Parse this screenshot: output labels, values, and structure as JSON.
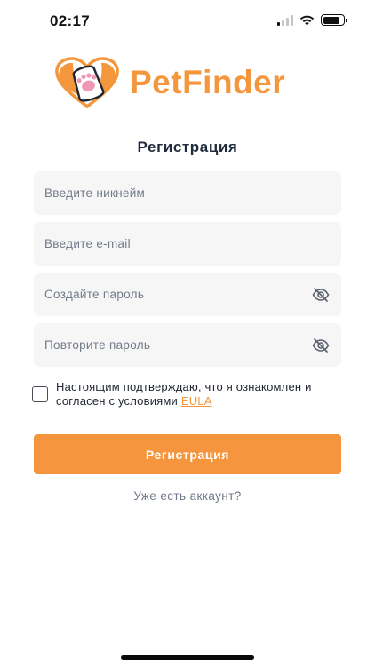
{
  "status_bar": {
    "time": "02:17",
    "signal_bars_active": 1,
    "battery_level": 0.85,
    "icons": [
      "signal-icon",
      "wifi-icon",
      "battery-icon"
    ]
  },
  "brand": {
    "name": "PetFinder",
    "logo_icon": "heart-paw-icon",
    "accent_color": "#f4963c"
  },
  "form": {
    "title": "Регистрация",
    "nickname_placeholder": "Введите никнейм",
    "email_placeholder": "Введите e-mail",
    "password_placeholder": "Создайте пароль",
    "repeat_password_placeholder": "Повторите пароль",
    "password_toggle_icon": "eye-off-icon",
    "eula_text": "Настоящим подтверждаю, что я ознакомлен и согласен с условиями ",
    "eula_link": "EULA",
    "eula_checked": false,
    "submit_label": "Регистрация",
    "login_link": "Уже есть аккаунт?"
  }
}
